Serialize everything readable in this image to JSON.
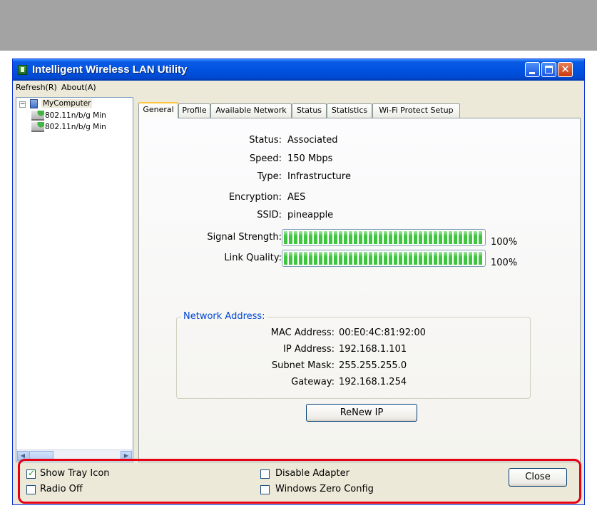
{
  "window": {
    "title": "Intelligent Wireless LAN Utility"
  },
  "menu": {
    "items": [
      "Refresh(R)",
      "About(A)"
    ]
  },
  "tree": {
    "root": "MyComputer",
    "adapters": [
      "802.11n/b/g Min",
      "802.11n/b/g Min"
    ]
  },
  "tabs": [
    "General",
    "Profile",
    "Available Network",
    "Status",
    "Statistics",
    "Wi-Fi Protect Setup"
  ],
  "active_tab": "General",
  "general": {
    "status_label": "Status:",
    "status_value": "Associated",
    "speed_label": "Speed:",
    "speed_value": "150 Mbps",
    "type_label": "Type:",
    "type_value": "Infrastructure",
    "encryption_label": "Encryption:",
    "encryption_value": "AES",
    "ssid_label": "SSID:",
    "ssid_value": "pineapple",
    "signal_label": "Signal Strength:",
    "signal_percent_text": "100%",
    "signal_level": 1.0,
    "link_label": "Link Quality:",
    "link_percent_text": "100%",
    "link_level": 1.0
  },
  "network_address": {
    "title": "Network Address:",
    "mac_label": "MAC Address:",
    "mac_value": "00:E0:4C:81:92:00",
    "ip_label": "IP Address:",
    "ip_value": "192.168.1.101",
    "subnet_label": "Subnet Mask:",
    "subnet_value": "255.255.255.0",
    "gateway_label": "Gateway:",
    "gateway_value": "192.168.1.254"
  },
  "buttons": {
    "renew_ip": "ReNew IP",
    "close": "Close"
  },
  "options": {
    "show_tray_icon": {
      "label": "Show Tray Icon",
      "checked": true
    },
    "radio_off": {
      "label": "Radio Off",
      "checked": false
    },
    "disable_adapter": {
      "label": "Disable Adapter",
      "checked": false
    },
    "windows_zero_config": {
      "label": "Windows Zero Config",
      "checked": false
    }
  },
  "colors": {
    "titlebar": "#0053e0",
    "meter_fill": "#3fc53f",
    "highlight_border": "#e60012",
    "group_title": "#0046d5"
  }
}
